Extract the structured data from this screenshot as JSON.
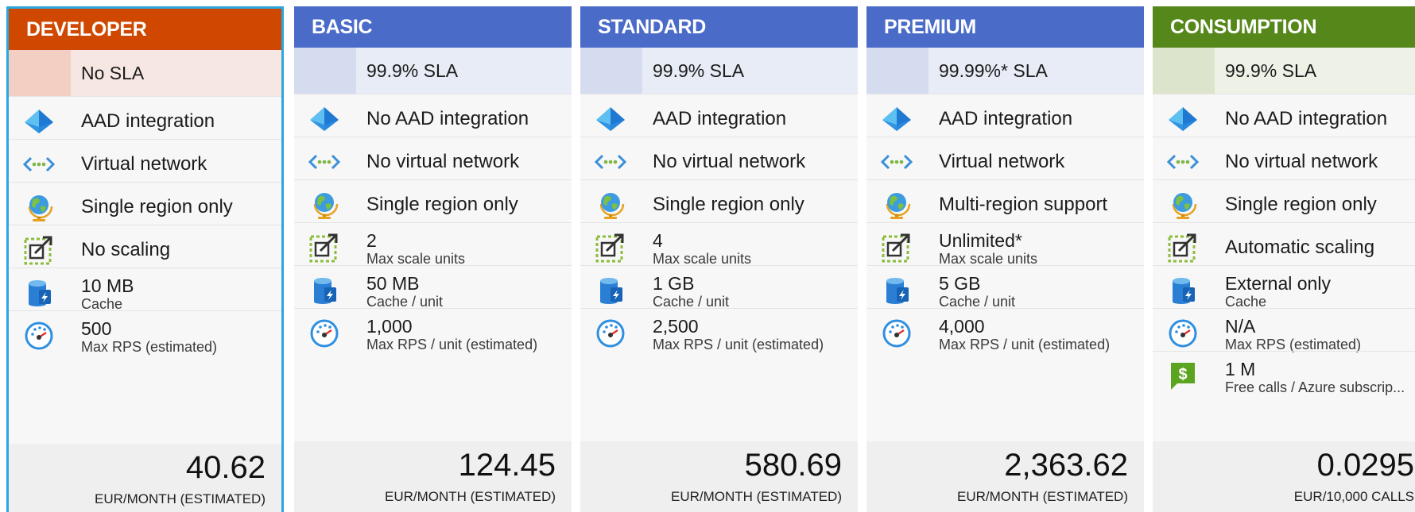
{
  "tiers": [
    {
      "name": "DEVELOPER",
      "header_color": "#d04800",
      "sla_tile_color": "#f3cfc3",
      "sla_row_color": "#f7e7e2",
      "sla": "No SLA",
      "aad": "AAD integration",
      "vnet": "Virtual network",
      "region": "Single region only",
      "scale_value": "No scaling",
      "scale_label": "",
      "cache_value": "10 MB",
      "cache_label": "Cache",
      "rps_value": "500",
      "rps_label": "Max RPS (estimated)",
      "calls_value": "",
      "calls_label": "",
      "price": "40.62",
      "price_unit": "EUR/MONTH (ESTIMATED)",
      "selected": true
    },
    {
      "name": "BASIC",
      "header_color": "#4a6bc8",
      "sla_tile_color": "#d6dcf0",
      "sla_row_color": "#e8ecf6",
      "sla": "99.9% SLA",
      "aad": "No AAD integration",
      "vnet": "No virtual network",
      "region": "Single region only",
      "scale_value": "2",
      "scale_label": "Max scale units",
      "cache_value": "50 MB",
      "cache_label": "Cache / unit",
      "rps_value": "1,000",
      "rps_label": "Max RPS / unit (estimated)",
      "calls_value": "",
      "calls_label": "",
      "price": "124.45",
      "price_unit": "EUR/MONTH (ESTIMATED)",
      "selected": false
    },
    {
      "name": "STANDARD",
      "header_color": "#4a6bc8",
      "sla_tile_color": "#d6dcf0",
      "sla_row_color": "#e8ecf6",
      "sla": "99.9% SLA",
      "aad": "AAD integration",
      "vnet": "No virtual network",
      "region": "Single region only",
      "scale_value": "4",
      "scale_label": "Max scale units",
      "cache_value": "1 GB",
      "cache_label": "Cache / unit",
      "rps_value": "2,500",
      "rps_label": "Max RPS / unit (estimated)",
      "calls_value": "",
      "calls_label": "",
      "price": "580.69",
      "price_unit": "EUR/MONTH (ESTIMATED)",
      "selected": false
    },
    {
      "name": "PREMIUM",
      "header_color": "#4a6bc8",
      "sla_tile_color": "#d6dcf0",
      "sla_row_color": "#e8ecf6",
      "sla": "99.99%* SLA",
      "aad": "AAD integration",
      "vnet": "Virtual network",
      "region": "Multi-region support",
      "scale_value": "Unlimited*",
      "scale_label": "Max scale units",
      "cache_value": "5 GB",
      "cache_label": "Cache / unit",
      "rps_value": "4,000",
      "rps_label": "Max RPS / unit (estimated)",
      "calls_value": "",
      "calls_label": "",
      "price": "2,363.62",
      "price_unit": "EUR/MONTH (ESTIMATED)",
      "selected": false
    },
    {
      "name": "CONSUMPTION",
      "header_color": "#55871a",
      "sla_tile_color": "#dce5cc",
      "sla_row_color": "#eef2e6",
      "sla": "99.9% SLA",
      "aad": "No AAD integration",
      "vnet": "No virtual network",
      "region": "Single region only",
      "scale_value": "Automatic scaling",
      "scale_label": "",
      "cache_value": "External only",
      "cache_label": "Cache",
      "rps_value": "N/A",
      "rps_label": "Max RPS (estimated)",
      "calls_value": "1 M",
      "calls_label": "Free calls / Azure subscrip...",
      "price": "0.0295",
      "price_unit": "EUR/10,000 CALLS",
      "selected": false
    }
  ],
  "icons": {
    "aad": "aad-diamond-icon",
    "vnet": "virtual-network-icon",
    "region": "globe-icon",
    "scale": "scale-icon",
    "cache": "cache-icon",
    "rps": "speedometer-icon",
    "calls": "dollar-icon"
  }
}
